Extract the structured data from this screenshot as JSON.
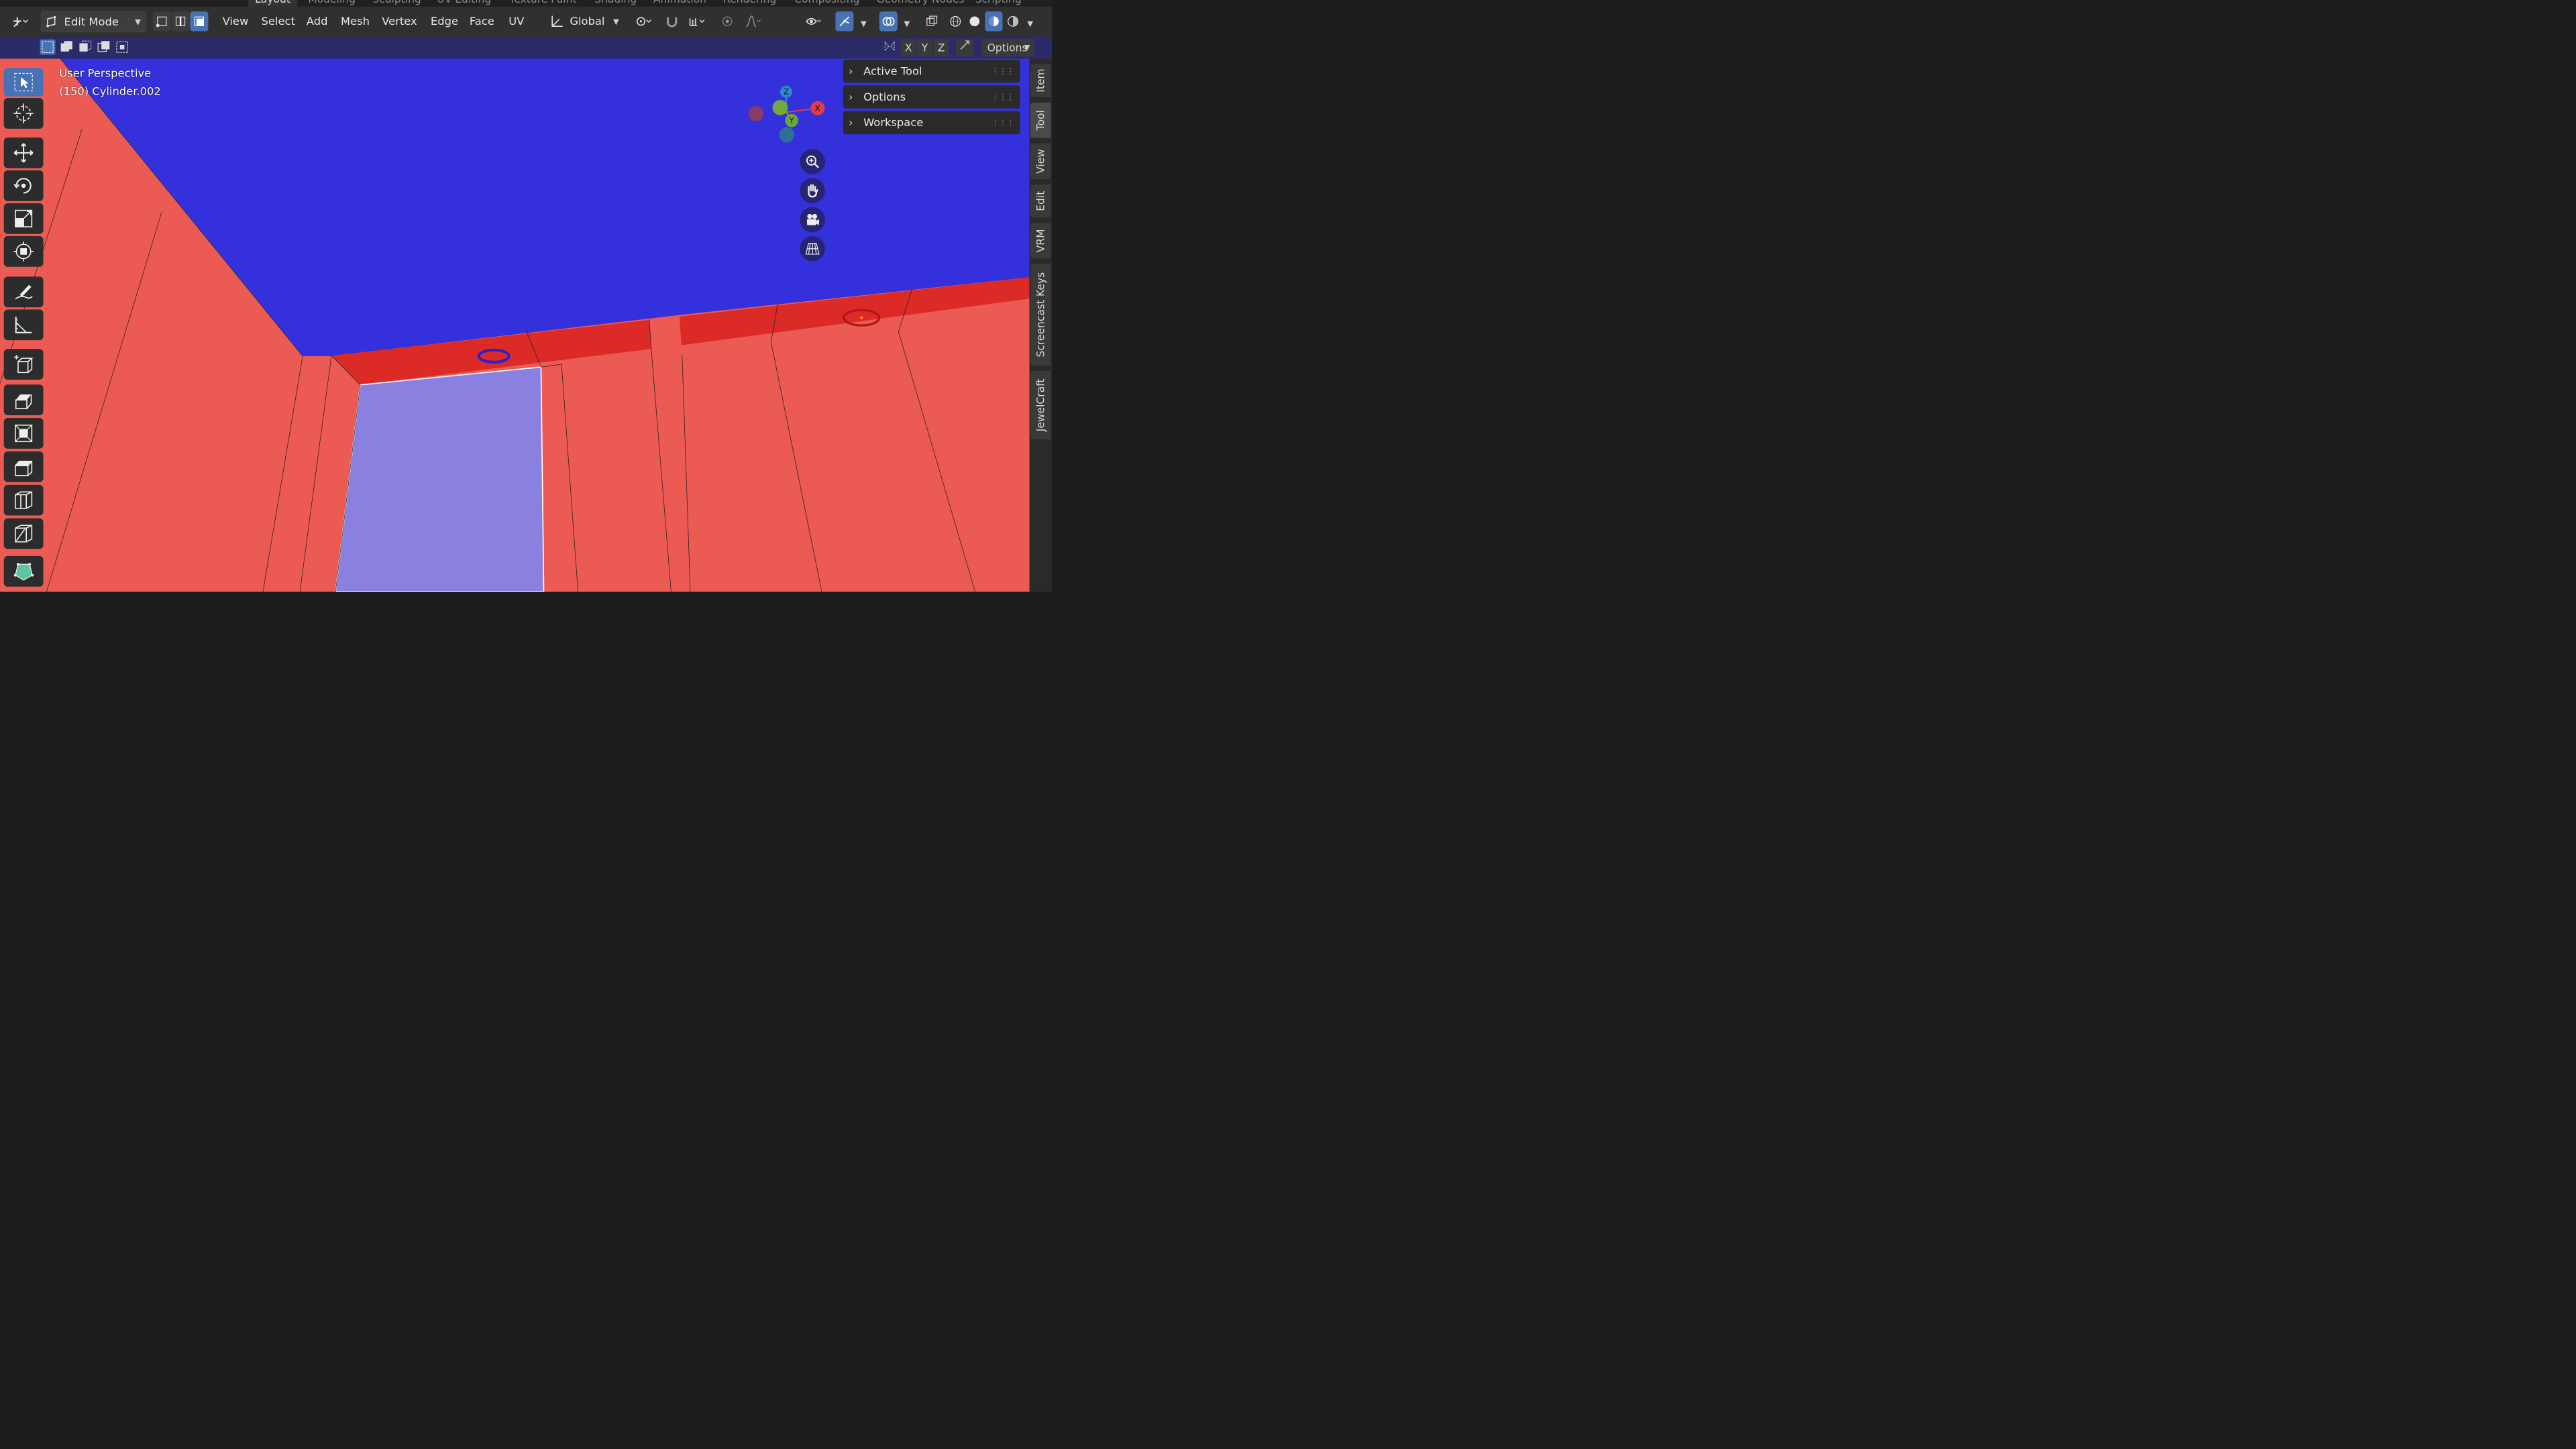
{
  "workspace_tabs": [
    "Layout",
    "Modeling",
    "Sculpting",
    "UV Editing",
    "Texture Paint",
    "Shading",
    "Animation",
    "Rendering",
    "Compositing",
    "Geometry Nodes",
    "Scripting"
  ],
  "header": {
    "mode": "Edit Mode",
    "menus": [
      "View",
      "Select",
      "Add",
      "Mesh",
      "Vertex",
      "Edge",
      "Face",
      "UV"
    ],
    "transform_orientation": "Global"
  },
  "subheader": {
    "axes": [
      "X",
      "Y",
      "Z"
    ],
    "options_label": "Options"
  },
  "viewport": {
    "view_name": "User Perspective",
    "object_info": "(150) Cylinder.002"
  },
  "gizmo": {
    "x": "X",
    "y": "Y",
    "z": "Z"
  },
  "npanel": {
    "panels": [
      {
        "title": "Active Tool"
      },
      {
        "title": "Options"
      },
      {
        "title": "Workspace"
      }
    ],
    "side_tabs": [
      "Item",
      "Tool",
      "View",
      "Edit",
      "VRM",
      "Screencast Keys",
      "JewelCraft"
    ]
  },
  "colors": {
    "ceiling": "#3430dc",
    "wall": "#eb5b54",
    "trim": "#dc2a26",
    "selected_face": "#8a80e0",
    "header": "#303030"
  },
  "icons": {
    "toolbar": [
      "select-box-icon",
      "cursor-icon",
      "move-icon",
      "rotate-icon",
      "scale-icon",
      "transform-icon",
      "annotate-icon",
      "measure-icon",
      "add-cube-icon",
      "extrude-icon",
      "inset-icon",
      "bevel-icon",
      "loop-cut-icon",
      "knife-icon",
      "poly-build-icon"
    ],
    "nav": [
      "zoom-icon",
      "hand-pan-icon",
      "camera-icon",
      "grid-perspective-icon"
    ]
  }
}
